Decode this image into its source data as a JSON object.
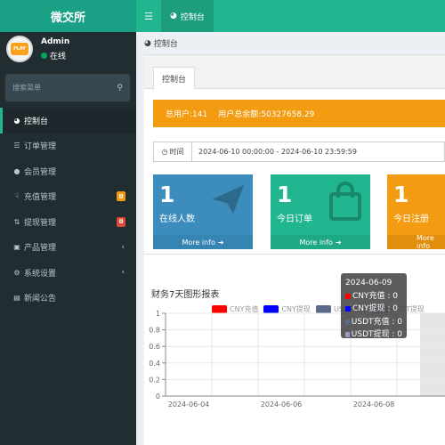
{
  "app": {
    "logo": "微交所"
  },
  "header": {
    "tab_label": "控制台"
  },
  "user": {
    "name": "Admin",
    "status": "在线",
    "avatar_text": "PLAY"
  },
  "sidebar": {
    "search_placeholder": "搜索菜单",
    "items": [
      {
        "label": "控制台",
        "icon": "dashboard-icon",
        "active": true
      },
      {
        "label": "订单管理",
        "icon": "list-icon"
      },
      {
        "label": "会员管理",
        "icon": "users-icon"
      },
      {
        "label": "充值管理",
        "icon": "hand-icon",
        "badge": "0",
        "badge_color": "#f39c12"
      },
      {
        "label": "提现管理",
        "icon": "exchange-icon",
        "badge": "0",
        "badge_color": "#dd4b39"
      },
      {
        "label": "产品管理",
        "icon": "bag-icon",
        "has_submenu": true
      },
      {
        "label": "系统设置",
        "icon": "cogs-icon",
        "has_submenu": true
      },
      {
        "label": "新闻公告",
        "icon": "news-icon"
      }
    ]
  },
  "breadcrumb": {
    "label": "控制台"
  },
  "panel": {
    "tab_label": "控制台"
  },
  "alert": {
    "total_users": "总用户:141",
    "total_balance": "用户总余额:50327658.29"
  },
  "time_filter": {
    "label": "时间",
    "value": "2024-06-10 00:00:00 - 2024-06-10 23:59:59"
  },
  "stats": [
    {
      "value": "1",
      "label": "在线人数",
      "footer": "More info",
      "color": "#3c8dbc"
    },
    {
      "value": "1",
      "label": "今日订单",
      "footer": "More info",
      "color": "#21b68f"
    },
    {
      "value": "1",
      "label": "今日注册",
      "footer": "More info",
      "color": "#f39c12"
    }
  ],
  "chart": {
    "title": "财务7天图形报表",
    "legend": [
      {
        "name": "CNY充值",
        "color": "#ff0000"
      },
      {
        "name": "CNY提现",
        "color": "#0000ff"
      },
      {
        "name": "USDT充值",
        "color": "#5a6a8a"
      },
      {
        "name": "USDT提现",
        "color": "#9999cc"
      }
    ],
    "tooltip": {
      "date": "2024-06-09",
      "rows": [
        {
          "label": "CNY充值 : 0",
          "color": "#ff0000"
        },
        {
          "label": "CNY提现 : 0",
          "color": "#0000ff"
        },
        {
          "label": "USDT充值 : 0",
          "color": "#5a6a8a"
        },
        {
          "label": "USDT提现 : 0",
          "color": "#9999cc"
        }
      ]
    }
  },
  "chart_data": {
    "type": "line",
    "x": [
      "2024-06-04",
      "2024-06-05",
      "2024-06-06",
      "2024-06-07",
      "2024-06-08",
      "2024-06-09"
    ],
    "x_tick_labels": [
      "2024-06-04",
      "2024-06-06",
      "2024-06-08"
    ],
    "y_ticks": [
      "0",
      "0.2",
      "0.4",
      "0.6",
      "0.8",
      "1"
    ],
    "ylim": [
      0,
      1
    ],
    "series": [
      {
        "name": "CNY充值",
        "values": [
          0,
          0,
          0,
          0,
          0,
          0
        ]
      },
      {
        "name": "CNY提现",
        "values": [
          0,
          0,
          0,
          0,
          0,
          0
        ]
      },
      {
        "name": "USDT充值",
        "values": [
          0,
          0,
          0,
          0,
          0,
          0
        ]
      },
      {
        "name": "USDT提现",
        "values": [
          0,
          0,
          0,
          0,
          0,
          0
        ]
      }
    ],
    "grid": true,
    "highlighted_x": "2024-06-09"
  }
}
